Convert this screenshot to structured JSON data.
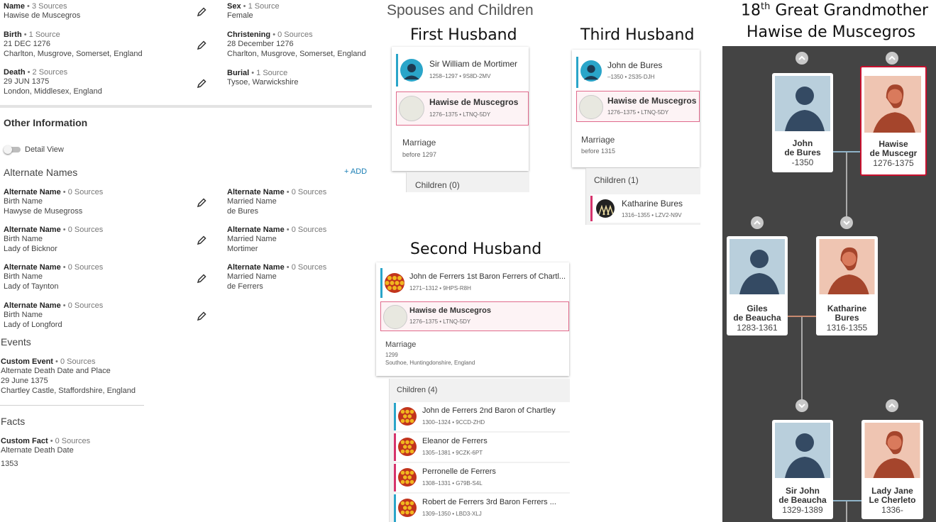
{
  "vitals": {
    "name": {
      "label": "Name",
      "sources": "3 Sources",
      "value": "Hawise de Muscegros"
    },
    "sex": {
      "label": "Sex",
      "sources": "1 Source",
      "value": "Female"
    },
    "birth": {
      "label": "Birth",
      "sources": "1 Source",
      "value1": "21 DEC 1276",
      "value2": "Charlton, Musgrove, Somerset, England"
    },
    "christening": {
      "label": "Christening",
      "sources": "0 Sources",
      "value1": "28 December 1276",
      "value2": "Charlton, Musgrove, Somerset, England"
    },
    "death": {
      "label": "Death",
      "sources": "2 Sources",
      "value1": "29 JUN 1375",
      "value2": "London, Middlesex, England"
    },
    "burial": {
      "label": "Burial",
      "sources": "1 Source",
      "value1": "Tysoe, Warwickshire"
    }
  },
  "other_info": {
    "title": "Other Information",
    "detail_view": "Detail View",
    "alt_names_title": "Alternate Names",
    "add_label": "+ ADD",
    "alt_names": [
      {
        "label": "Alternate Name",
        "sources": "0 Sources",
        "type": "Birth Name",
        "value": "Hawyse de Musegross"
      },
      {
        "label": "Alternate Name",
        "sources": "0 Sources",
        "type": "Married Name",
        "value": "de Bures"
      },
      {
        "label": "Alternate Name",
        "sources": "0 Sources",
        "type": "Birth Name",
        "value": "Lady of Bicknor"
      },
      {
        "label": "Alternate Name",
        "sources": "0 Sources",
        "type": "Married Name",
        "value": "Mortimer"
      },
      {
        "label": "Alternate Name",
        "sources": "0 Sources",
        "type": "Birth Name",
        "value": "Lady of Taynton"
      },
      {
        "label": "Alternate Name",
        "sources": "0 Sources",
        "type": "Married Name",
        "value": "de Ferrers"
      },
      {
        "label": "Alternate Name",
        "sources": "0 Sources",
        "type": "Birth Name",
        "value": "Lady of Longford"
      }
    ],
    "events_title": "Events",
    "event": {
      "label": "Custom Event",
      "sources": "0 Sources",
      "line1": "Alternate Death Date and Place",
      "line2": "29 June 1375",
      "line3": "Chartley Castle, Staffordshire, England"
    },
    "facts_title": "Facts",
    "fact": {
      "label": "Custom Fact",
      "sources": "0 Sources",
      "line1": "Alternate Death Date",
      "line2": "1353"
    }
  },
  "spouses": {
    "title": "Spouses and Children",
    "first": {
      "heading": "First Husband",
      "husband": {
        "name": "Sir William de Mortimer",
        "meta": "1258–1297 • 9S8D-2MV"
      },
      "wife": {
        "name": "Hawise de Muscegros",
        "meta": "1276–1375 • LTNQ-5DY"
      },
      "marriage_label": "Marriage",
      "marriage_date": "before 1297",
      "children_label": "Children (0)"
    },
    "second": {
      "heading": "Second Husband",
      "husband": {
        "name": "John de Ferrers 1st Baron Ferrers of Chartl...",
        "meta": "1271–1312 • 9HPS-R8H"
      },
      "wife": {
        "name": "Hawise de Muscegros",
        "meta": "1276–1375 • LTNQ-5DY"
      },
      "marriage_label": "Marriage",
      "marriage_date": "1299",
      "marriage_place": "Southoe, Huntingdonshire, England",
      "children_label": "Children (4)",
      "children": [
        {
          "name": "John de Ferrers 2nd Baron of Chartley",
          "meta": "1300–1324 • 9CCD-ZHD",
          "sex": "male"
        },
        {
          "name": "Eleanor de Ferrers",
          "meta": "1305–1381 • 9CZK-6PT",
          "sex": "female"
        },
        {
          "name": "Perronelle de Ferrers",
          "meta": "1308–1331 • G79B-S4L",
          "sex": "female"
        },
        {
          "name": "Robert de Ferrers 3rd Baron Ferrers ...",
          "meta": "1309–1350 • LBD3-XLJ",
          "sex": "male"
        }
      ]
    },
    "third": {
      "heading": "Third Husband",
      "husband": {
        "name": "John de Bures",
        "meta": "–1350 • 2S35-DJH"
      },
      "wife": {
        "name": "Hawise de Muscegros",
        "meta": "1276–1375 • LTNQ-5DY"
      },
      "marriage_label": "Marriage",
      "marriage_date": "before 1315",
      "children_label": "Children (1)",
      "children": [
        {
          "name": "Katharine Bures",
          "meta": "1316–1355 • LZV2-N9V",
          "sex": "female"
        }
      ]
    }
  },
  "tree": {
    "title_prefix": "18",
    "title_sup": "th",
    "title_rest": " Great Grandmother",
    "subtitle": "Hawise de Muscegros",
    "cards": {
      "john": {
        "line1": "John",
        "line2": "de Bures",
        "dates": "-1350"
      },
      "hawise": {
        "line1": "Hawise",
        "line2": "de Muscegr",
        "dates": "1276-1375"
      },
      "giles": {
        "line1": "Giles",
        "line2": "de Beaucha",
        "dates": "1283-1361"
      },
      "katharine": {
        "line1": "Katharine",
        "line2": "Bures",
        "dates": "1316-1355"
      },
      "sirjohn": {
        "line1": "Sir John",
        "line2": "de Beaucha",
        "dates": "1329-1389"
      },
      "ladyjane": {
        "line1": "Lady Jane",
        "line2": "Le Cherleto",
        "dates": "1336-"
      }
    }
  },
  "colors": {
    "male": "#2aa5c9",
    "female": "#d6336c",
    "tree_bg": "#444444",
    "selected": "#c8102e"
  }
}
